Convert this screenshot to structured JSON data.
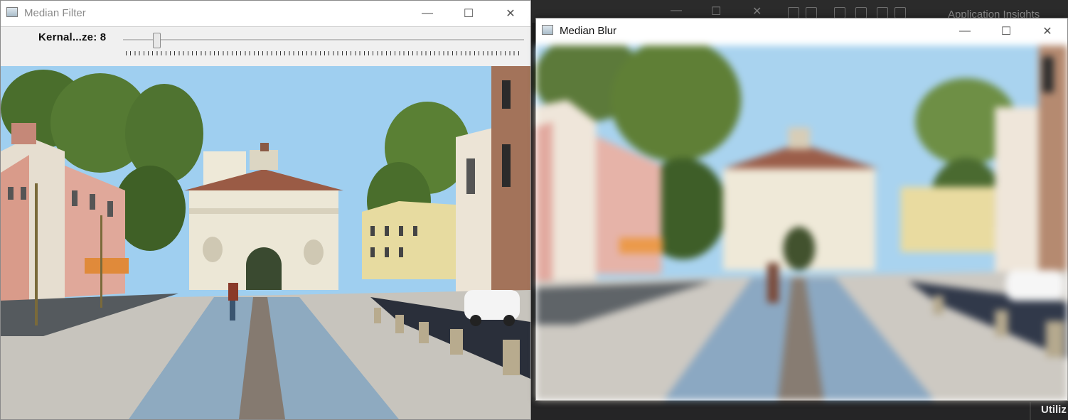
{
  "background_app": {
    "insights_label": "Application Insights",
    "status_text": "Utiliz"
  },
  "window_filter": {
    "title": "Median Filter",
    "trackbar": {
      "label": "Kernal...ze: 8",
      "value": 8
    },
    "controls": {
      "minimize": "—",
      "maximize": "☐",
      "close": "✕"
    }
  },
  "window_blur": {
    "title": "Median Blur",
    "controls": {
      "minimize": "—",
      "maximize": "☐",
      "close": "✕"
    }
  },
  "colors": {
    "sky": "#9fcff0",
    "road": "#8eaac0",
    "pavement": "#c7c4bd",
    "foliage": "#4f7330"
  }
}
